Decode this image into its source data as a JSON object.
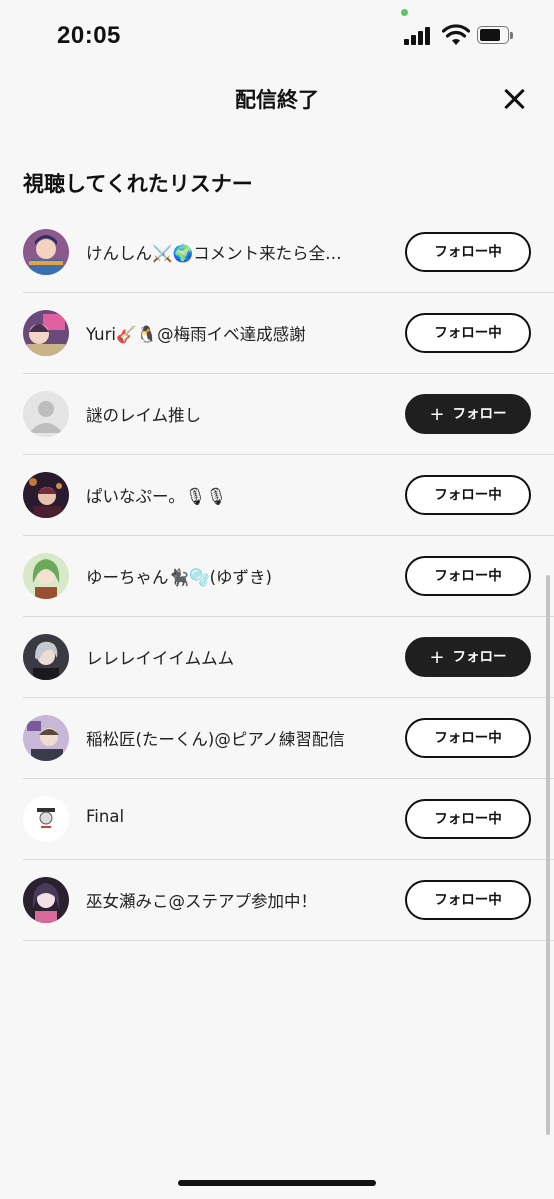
{
  "status_bar": {
    "time": "20:05"
  },
  "header": {
    "title": "配信終了"
  },
  "section": {
    "title": "視聴してくれたリスナー"
  },
  "listeners": [
    {
      "name": "けんしん⚔️🌍コメント来たら全…",
      "button": "フォロー中",
      "following": true
    },
    {
      "name": " Yuri🎸🐧@梅雨イベ達成感謝",
      "button": "フォロー中",
      "following": true
    },
    {
      "name": "謎のレイム推し",
      "button": "フォロー",
      "following": false
    },
    {
      "name": "ぱいなぷー。🎙🎙",
      "button": "フォロー中",
      "following": true
    },
    {
      "name": "ゆーちゃん🐈‍⬛🫧(ゆずき)",
      "button": "フォロー中",
      "following": true
    },
    {
      "name": "レレレイイイムムム",
      "button": "フォロー",
      "following": false
    },
    {
      "name": "稲松匠(たーくん)@ピアノ練習配信",
      "button": "フォロー中",
      "following": true
    },
    {
      "name": "Final",
      "button": "フォロー中",
      "following": true
    },
    {
      "name": "巫女瀬みこ@ステアプ参加中！",
      "button": "フォロー中",
      "following": true
    }
  ],
  "follow_plus_icon": "+"
}
